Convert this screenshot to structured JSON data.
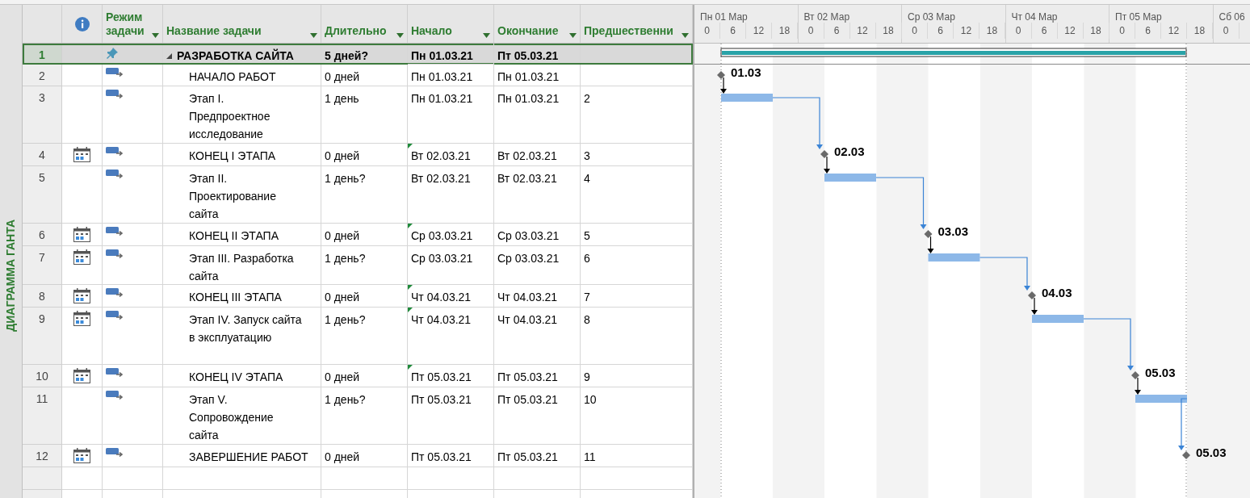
{
  "sidebar_label": "ДИАГРАММА ГАНТА",
  "columns": [
    "Режим задачи",
    "Название задачи",
    "Длительно",
    "Начало",
    "Окончание",
    "Предшественни"
  ],
  "timescale": [
    {
      "day": "Пн 01 Мар",
      "hours": [
        "0",
        "6",
        "12",
        "18"
      ]
    },
    {
      "day": "Вт 02 Мар",
      "hours": [
        "0",
        "6",
        "12",
        "18"
      ]
    },
    {
      "day": "Ср 03 Мар",
      "hours": [
        "0",
        "6",
        "12",
        "18"
      ]
    },
    {
      "day": "Чт 04 Мар",
      "hours": [
        "0",
        "6",
        "12",
        "18"
      ]
    },
    {
      "day": "Пт 05 Мар",
      "hours": [
        "0",
        "6",
        "12",
        "18"
      ]
    },
    {
      "day": "Сб 06",
      "hours": [
        "0"
      ]
    }
  ],
  "tasks": [
    {
      "id": "1",
      "kind": "summary",
      "expanded": true,
      "selected": true,
      "manually_scheduled": true,
      "calendar": false,
      "name": "РАЗРАБОТКА САЙТА",
      "duration": "5 дней?",
      "start": "Пн 01.03.21",
      "start_flag": false,
      "finish": "Пт 05.03.21"
    },
    {
      "id": "2",
      "kind": "milestone",
      "selected": false,
      "manually_scheduled": false,
      "calendar": false,
      "name": "НАЧАЛО РАБОТ",
      "duration": "0 дней",
      "start": "Пн 01.03.21",
      "start_flag": false,
      "finish": "Пн 01.03.21",
      "gantt_label": "01.03"
    },
    {
      "id": "3",
      "kind": "task",
      "selected": false,
      "manually_scheduled": false,
      "calendar": false,
      "name": "Этап I. Предпроектное исследование",
      "duration": "1 день",
      "start": "Пн 01.03.21",
      "start_flag": false,
      "finish": "Пн 01.03.21",
      "predecessors": "2"
    },
    {
      "id": "4",
      "kind": "milestone",
      "selected": false,
      "manually_scheduled": false,
      "calendar": true,
      "name": "КОНЕЦ I ЭТАПА",
      "duration": "0 дней",
      "start": "Вт 02.03.21",
      "start_flag": true,
      "finish": "Вт 02.03.21",
      "predecessors": "3",
      "gantt_label": "02.03"
    },
    {
      "id": "5",
      "kind": "task",
      "selected": false,
      "manually_scheduled": false,
      "calendar": false,
      "name": "Этап II. Проектирование сайта",
      "duration": "1 день?",
      "start": "Вт 02.03.21",
      "start_flag": false,
      "finish": "Вт 02.03.21",
      "predecessors": "4"
    },
    {
      "id": "6",
      "kind": "milestone",
      "selected": false,
      "manually_scheduled": false,
      "calendar": true,
      "name": "КОНЕЦ II ЭТАПА",
      "duration": "0 дней",
      "start": "Ср 03.03.21",
      "start_flag": true,
      "finish": "Ср 03.03.21",
      "predecessors": "5",
      "gantt_label": "03.03"
    },
    {
      "id": "7",
      "kind": "task",
      "selected": false,
      "manually_scheduled": false,
      "calendar": true,
      "name": "Этап III. Разработка сайта",
      "duration": "1 день?",
      "start": "Ср 03.03.21",
      "start_flag": false,
      "finish": "Ср 03.03.21",
      "predecessors": "6"
    },
    {
      "id": "8",
      "kind": "milestone",
      "selected": false,
      "manually_scheduled": false,
      "calendar": true,
      "name": "КОНЕЦ III ЭТАПА",
      "duration": "0 дней",
      "start": "Чт 04.03.21",
      "start_flag": true,
      "finish": "Чт 04.03.21",
      "predecessors": "7",
      "gantt_label": "04.03"
    },
    {
      "id": "9",
      "kind": "task",
      "selected": false,
      "manually_scheduled": false,
      "calendar": true,
      "name": "Этап IV. Запуск сайта в эксплуатацию",
      "duration": "1 день?",
      "start": "Чт 04.03.21",
      "start_flag": true,
      "finish": "Чт 04.03.21",
      "predecessors": "8"
    },
    {
      "id": "10",
      "kind": "milestone",
      "selected": false,
      "manually_scheduled": false,
      "calendar": true,
      "name": "КОНЕЦ IV ЭТАПА",
      "duration": "0 дней",
      "start": "Пт 05.03.21",
      "start_flag": true,
      "finish": "Пт 05.03.21",
      "predecessors": "9",
      "gantt_label": "05.03"
    },
    {
      "id": "11",
      "kind": "task",
      "selected": false,
      "manually_scheduled": false,
      "calendar": false,
      "name": "Этап V. Сопровождение сайта",
      "duration": "1 день?",
      "start": "Пт 05.03.21",
      "start_flag": false,
      "finish": "Пт 05.03.21",
      "predecessors": "10"
    },
    {
      "id": "12",
      "kind": "milestone",
      "selected": false,
      "manually_scheduled": false,
      "calendar": true,
      "name": "ЗАВЕРШЕНИЕ РАБОТ",
      "duration": "0 дней",
      "start": "Пт 05.03.21",
      "start_flag": false,
      "finish": "Пт 05.03.21",
      "predecessors": "11",
      "gantt_label": "05.03"
    }
  ]
}
